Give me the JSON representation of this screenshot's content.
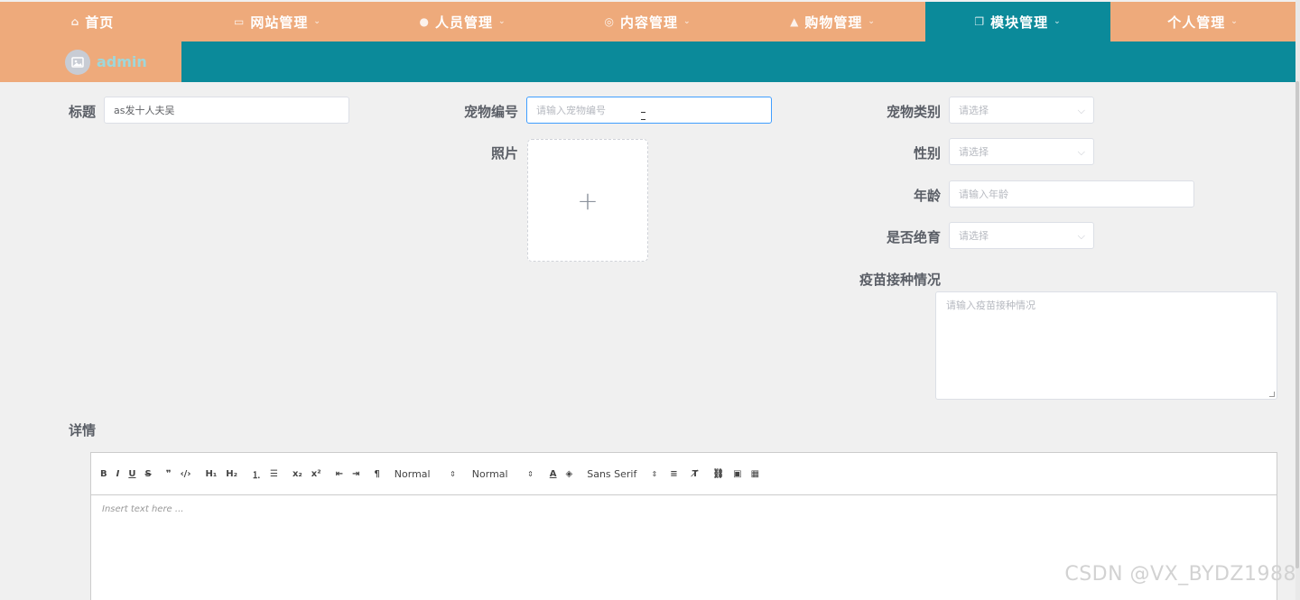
{
  "nav": {
    "items": [
      {
        "icon": "home-icon",
        "glyph": "⌂",
        "label": "首页",
        "caret": ""
      },
      {
        "icon": "monitor-icon",
        "glyph": "▭",
        "label": "网站管理",
        "caret": "⌄"
      },
      {
        "icon": "user-icon",
        "glyph": "●",
        "label": "人员管理",
        "caret": "⌄"
      },
      {
        "icon": "content-icon",
        "glyph": "◎",
        "label": "内容管理",
        "caret": "⌄"
      },
      {
        "icon": "lock-icon",
        "glyph": "▲",
        "label": "购物管理",
        "caret": "⌄"
      },
      {
        "icon": "module-icon",
        "glyph": "❐",
        "label": "模块管理",
        "caret": "⌄"
      },
      {
        "icon": "",
        "glyph": "",
        "label": "个人管理",
        "caret": "⌄"
      }
    ],
    "active_index": 5
  },
  "user": {
    "name": "admin",
    "avatar_icon": "image-icon"
  },
  "form": {
    "title_label": "标题",
    "title_value": "as发十人夫吴",
    "pet_no_label": "宠物编号",
    "pet_no_placeholder": "请输入宠物编号",
    "photo_label": "照片",
    "upload_plus": "+",
    "pet_type_label": "宠物类别",
    "pet_type_placeholder": "请选择",
    "gender_label": "性别",
    "gender_placeholder": "请选择",
    "age_label": "年龄",
    "age_placeholder": "请输入年龄",
    "sterilized_label": "是否绝育",
    "sterilized_placeholder": "请选择",
    "vaccine_label": "疫苗接种情况",
    "vaccine_placeholder": "请输入疫苗接种情况",
    "detail_label": "详情"
  },
  "editor": {
    "tools": [
      {
        "name": "bold-button",
        "glyph": "B"
      },
      {
        "name": "italic-button",
        "glyph": "I"
      },
      {
        "name": "underline-button",
        "glyph": "U"
      },
      {
        "name": "strike-button",
        "glyph": "S"
      },
      {
        "name": "blockquote-button",
        "glyph": "❞"
      },
      {
        "name": "code-block-button",
        "glyph": "‹/›"
      },
      {
        "name": "h1-button",
        "glyph": "H₁"
      },
      {
        "name": "h2-button",
        "glyph": "H₂"
      },
      {
        "name": "ordered-list-button",
        "glyph": "⒈"
      },
      {
        "name": "bullet-list-button",
        "glyph": "☰"
      },
      {
        "name": "subscript-button",
        "glyph": "x₂"
      },
      {
        "name": "superscript-button",
        "glyph": "x²"
      },
      {
        "name": "outdent-button",
        "glyph": "⇤"
      },
      {
        "name": "indent-button",
        "glyph": "⇥"
      },
      {
        "name": "direction-button",
        "glyph": "¶"
      }
    ],
    "size_picker": "Normal",
    "header_picker": "Normal",
    "color_glyph": "A",
    "background_glyph": "◈",
    "font_picker": "Sans Serif",
    "align_glyph": "≡",
    "clean_glyph": "T̸",
    "link_glyph": "⛓",
    "image_glyph": "▣",
    "video_glyph": "▦",
    "body_placeholder": "Insert text here ..."
  },
  "watermark": "CSDN @VX_BYDZ1988"
}
